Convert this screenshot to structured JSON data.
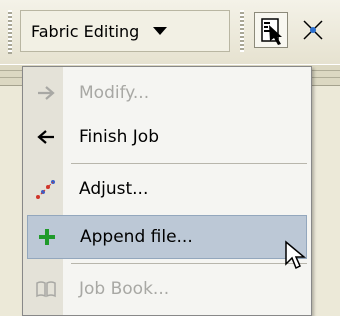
{
  "toolbar": {
    "dropdown_label": "Fabric Editing",
    "icons": [
      "fabric-edit-tool-icon",
      "vertex-cross-icon"
    ]
  },
  "menu": {
    "items": [
      {
        "label": "Modify...",
        "icon": "arrow-right-icon",
        "enabled": false
      },
      {
        "label": "Finish Job",
        "icon": "arrow-left-icon",
        "enabled": true
      },
      {
        "label": "Adjust...",
        "icon": "adjust-dots-icon",
        "enabled": true
      },
      {
        "label": "Append file...",
        "icon": "green-plus-icon",
        "enabled": true,
        "highlighted": true
      },
      {
        "label": "Job Book...",
        "icon": "book-icon",
        "enabled": false
      }
    ]
  },
  "colors": {
    "highlight": "#bcc8d6",
    "plus_green": "#1f9a2a",
    "adjust_red": "#d0362a",
    "adjust_blue": "#3a5ec8"
  }
}
